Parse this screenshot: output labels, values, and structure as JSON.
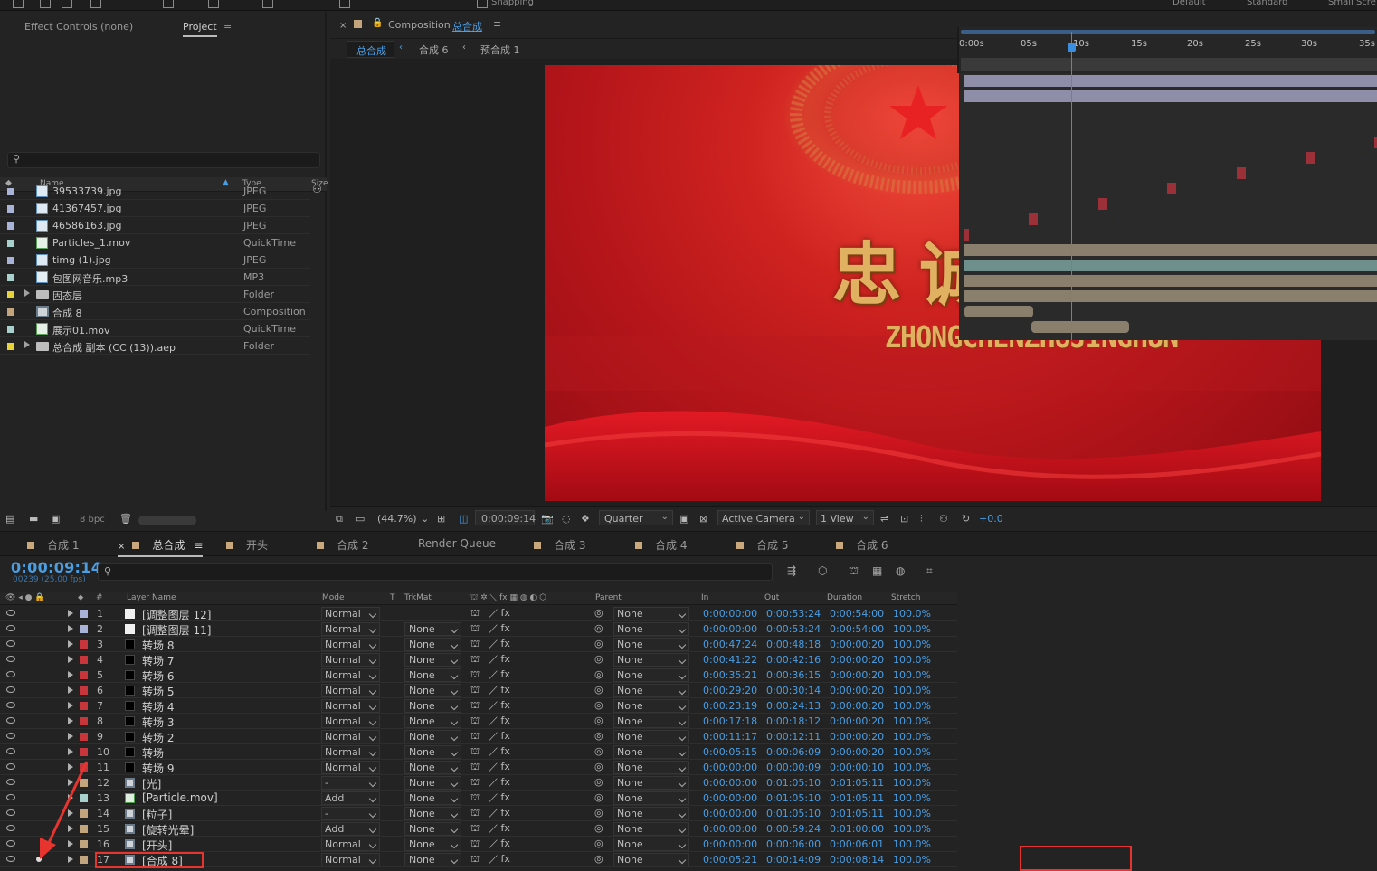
{
  "topbar": {
    "snapping": "Snapping",
    "ws1": "Default",
    "ws2": "Standard",
    "ws3": "Small Scre"
  },
  "left": {
    "tab_effects": "Effect Controls (none)",
    "tab_project": "Project",
    "col_name": "Name",
    "col_type": "Type",
    "col_size": "Size",
    "bpc": "8 bpc",
    "items": [
      {
        "name": "39533739.jpg",
        "type": "JPEG",
        "label": "#a9b3d7",
        "icon": "image"
      },
      {
        "name": "41367457.jpg",
        "type": "JPEG",
        "label": "#a9b3d7",
        "icon": "image"
      },
      {
        "name": "46586163.jpg",
        "type": "JPEG",
        "label": "#a9b3d7",
        "icon": "image"
      },
      {
        "name": "Particles_1.mov",
        "type": "QuickTime",
        "label": "#a8d0cc",
        "icon": "video"
      },
      {
        "name": "timg (1).jpg",
        "type": "JPEG",
        "label": "#a9b3d7",
        "icon": "image"
      },
      {
        "name": "包图网音乐.mp3",
        "type": "MP3",
        "label": "#a8d0cc",
        "icon": "audio"
      },
      {
        "name": "固态层",
        "type": "Folder",
        "label": "#e6d33a",
        "icon": "folder"
      },
      {
        "name": "合成 8",
        "type": "Composition",
        "label": "#c2a47d",
        "icon": "comp"
      },
      {
        "name": "展示01.mov",
        "type": "QuickTime",
        "label": "#a8d0cc",
        "icon": "video"
      },
      {
        "name": "总合成 副本 (CC (13)).aep",
        "type": "Folder",
        "label": "#e6d33a",
        "icon": "folder"
      }
    ]
  },
  "viewer": {
    "tab_prefix": "Composition",
    "tab_name": "总合成",
    "crumbs": [
      "总合成",
      "合成 6",
      "预合成 1"
    ],
    "canvas_title": "忠诚铸警魂",
    "canvas_sub": "ZHONGCHENZHUJINGHUN",
    "zoom": "(44.7%)",
    "time": "0:00:09:14",
    "resolution": "Quarter",
    "camera": "Active Camera",
    "views": "1 View",
    "exposure": "+0.0"
  },
  "timeline": {
    "tabs": [
      "合成 1",
      "总合成",
      "开头",
      "合成 2",
      "Render Queue",
      "合成 3",
      "合成 4",
      "合成 5",
      "合成 6"
    ],
    "timecode": "0:00:09:14",
    "fps": "00239 (25.00 fps)",
    "headers": {
      "name": "Layer Name",
      "mode": "Mode",
      "t": "T",
      "trkmat": "TrkMat",
      "parent": "Parent",
      "in": "In",
      "out": "Out",
      "duration": "Duration",
      "stretch": "Stretch",
      "num": "#"
    },
    "ruler": [
      "0:00s",
      "05s",
      "10s",
      "15s",
      "20s",
      "25s",
      "30s",
      "35s"
    ],
    "layers": [
      {
        "num": "1",
        "name": "[调整图层 12]",
        "mode": "Normal",
        "trk": "",
        "parent": "None",
        "in": "0:00:00:00",
        "out": "0:00:53:24",
        "dur": "0:00:54:00",
        "stretch": "100.0%",
        "label": "#a9b3d7",
        "icon": "white"
      },
      {
        "num": "2",
        "name": "[调整图层 11]",
        "mode": "Normal",
        "trk": "None",
        "parent": "None",
        "in": "0:00:00:00",
        "out": "0:00:53:24",
        "dur": "0:00:54:00",
        "stretch": "100.0%",
        "label": "#a9b3d7",
        "icon": "white"
      },
      {
        "num": "3",
        "name": "转场 8",
        "mode": "Normal",
        "trk": "None",
        "parent": "None",
        "in": "0:00:47:24",
        "out": "0:00:48:18",
        "dur": "0:00:00:20",
        "stretch": "100.0%",
        "label": "#c8353a",
        "icon": "black"
      },
      {
        "num": "4",
        "name": "转场 7",
        "mode": "Normal",
        "trk": "None",
        "parent": "None",
        "in": "0:00:41:22",
        "out": "0:00:42:16",
        "dur": "0:00:00:20",
        "stretch": "100.0%",
        "label": "#c8353a",
        "icon": "black"
      },
      {
        "num": "5",
        "name": "转场 6",
        "mode": "Normal",
        "trk": "None",
        "parent": "None",
        "in": "0:00:35:21",
        "out": "0:00:36:15",
        "dur": "0:00:00:20",
        "stretch": "100.0%",
        "label": "#c8353a",
        "icon": "black"
      },
      {
        "num": "6",
        "name": "转场 5",
        "mode": "Normal",
        "trk": "None",
        "parent": "None",
        "in": "0:00:29:20",
        "out": "0:00:30:14",
        "dur": "0:00:00:20",
        "stretch": "100.0%",
        "label": "#c8353a",
        "icon": "black"
      },
      {
        "num": "7",
        "name": "转场 4",
        "mode": "Normal",
        "trk": "None",
        "parent": "None",
        "in": "0:00:23:19",
        "out": "0:00:24:13",
        "dur": "0:00:00:20",
        "stretch": "100.0%",
        "label": "#c8353a",
        "icon": "black"
      },
      {
        "num": "8",
        "name": "转场 3",
        "mode": "Normal",
        "trk": "None",
        "parent": "None",
        "in": "0:00:17:18",
        "out": "0:00:18:12",
        "dur": "0:00:00:20",
        "stretch": "100.0%",
        "label": "#c8353a",
        "icon": "black"
      },
      {
        "num": "9",
        "name": "转场 2",
        "mode": "Normal",
        "trk": "None",
        "parent": "None",
        "in": "0:00:11:17",
        "out": "0:00:12:11",
        "dur": "0:00:00:20",
        "stretch": "100.0%",
        "label": "#c8353a",
        "icon": "black"
      },
      {
        "num": "10",
        "name": "转场",
        "mode": "Normal",
        "trk": "None",
        "parent": "None",
        "in": "0:00:05:15",
        "out": "0:00:06:09",
        "dur": "0:00:00:20",
        "stretch": "100.0%",
        "label": "#c8353a",
        "icon": "black"
      },
      {
        "num": "11",
        "name": "转场 9",
        "mode": "Normal",
        "trk": "None",
        "parent": "None",
        "in": "0:00:00:00",
        "out": "0:00:00:09",
        "dur": "0:00:00:10",
        "stretch": "100.0%",
        "label": "#c8353a",
        "icon": "black"
      },
      {
        "num": "12",
        "name": "[光]",
        "mode": "-",
        "trk": "None",
        "parent": "None",
        "in": "0:00:00:00",
        "out": "0:01:05:10",
        "dur": "0:01:05:11",
        "stretch": "100.0%",
        "label": "#c2a47d",
        "icon": "comp"
      },
      {
        "num": "13",
        "name": "[Particle.mov]",
        "mode": "Add",
        "trk": "None",
        "parent": "None",
        "in": "0:00:00:00",
        "out": "0:01:05:10",
        "dur": "0:01:05:11",
        "stretch": "100.0%",
        "label": "#a8d0cc",
        "icon": "video"
      },
      {
        "num": "14",
        "name": "[粒子]",
        "mode": "-",
        "trk": "None",
        "parent": "None",
        "in": "0:00:00:00",
        "out": "0:01:05:10",
        "dur": "0:01:05:11",
        "stretch": "100.0%",
        "label": "#c2a47d",
        "icon": "comp"
      },
      {
        "num": "15",
        "name": "[旋转光晕]",
        "mode": "Add",
        "trk": "None",
        "parent": "None",
        "in": "0:00:00:00",
        "out": "0:00:59:24",
        "dur": "0:01:00:00",
        "stretch": "100.0%",
        "label": "#c2a47d",
        "icon": "comp"
      },
      {
        "num": "16",
        "name": "[开头]",
        "mode": "Normal",
        "trk": "None",
        "parent": "None",
        "in": "0:00:00:00",
        "out": "0:00:06:00",
        "dur": "0:00:06:01",
        "stretch": "100.0%",
        "label": "#c2a47d",
        "icon": "comp"
      },
      {
        "num": "17",
        "name": "[合成 8]",
        "mode": "Normal",
        "trk": "None",
        "parent": "None",
        "in": "0:00:05:21",
        "out": "0:00:14:09",
        "dur": "0:00:08:14",
        "stretch": "100.0%",
        "label": "#c2a47d",
        "icon": "comp"
      }
    ]
  }
}
